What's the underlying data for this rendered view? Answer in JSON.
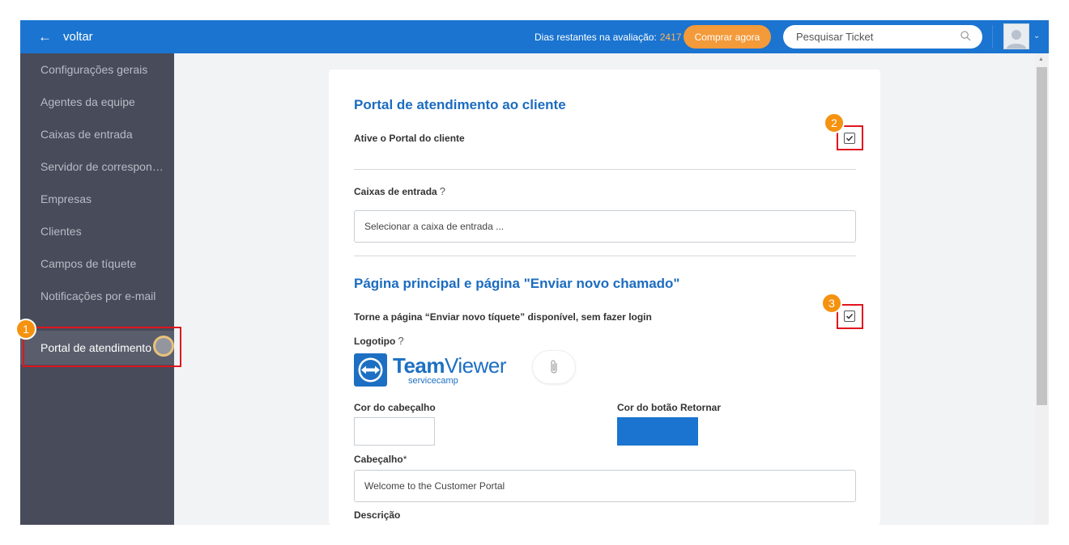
{
  "header": {
    "back_label": "voltar",
    "trial_label": "Dias restantes na avaliação:",
    "trial_days": "2417",
    "buy_label": "Comprar agora",
    "search_placeholder": "Pesquisar Ticket"
  },
  "sidebar": {
    "items": [
      {
        "label": "Configurações gerais"
      },
      {
        "label": "Agentes da equipe"
      },
      {
        "label": "Caixas de entrada"
      },
      {
        "label": "Servidor de correspondência"
      },
      {
        "label": "Empresas"
      },
      {
        "label": "Clientes"
      },
      {
        "label": "Campos de tíquete"
      },
      {
        "label": "Notificações por e-mail"
      },
      {
        "label": "Portal de atendimento"
      }
    ],
    "active_index": 8
  },
  "portal": {
    "title": "Portal de atendimento ao cliente",
    "enable_label": "Ative o Portal do cliente",
    "enable_checked": true,
    "inbox_label": "Caixas de entrada",
    "inbox_help": "?",
    "inbox_placeholder": "Selecionar a caixa de entrada ..."
  },
  "main_page": {
    "title": "Página principal e página \"Enviar novo chamado\"",
    "no_login_label": "Torne a página “Enviar novo tíquete” disponível, sem fazer login",
    "no_login_checked": true,
    "logo_label": "Logotipo",
    "logo_help": "?",
    "logo_brand_bold": "Team",
    "logo_brand_light": "Viewer",
    "logo_sub": "servicecamp",
    "header_color_label": "Cor do cabeçalho",
    "header_color": "#ffffff",
    "return_color_label": "Cor do botão Retornar",
    "return_color": "#1a74d0",
    "header_text_label": "Cabeçalho",
    "header_required": "*",
    "header_text_value": "Welcome to the Customer Portal",
    "description_label": "Descrição"
  },
  "annotations": {
    "badge1": "1",
    "badge2": "2",
    "badge3": "3",
    "highlight_color": "#e0161e",
    "badge_color": "#f5920f"
  },
  "colors": {
    "topbar": "#1a74d0",
    "sidebar": "#474b5a",
    "accent_orange": "#f39a3a",
    "title_blue": "#1c6cc0"
  }
}
